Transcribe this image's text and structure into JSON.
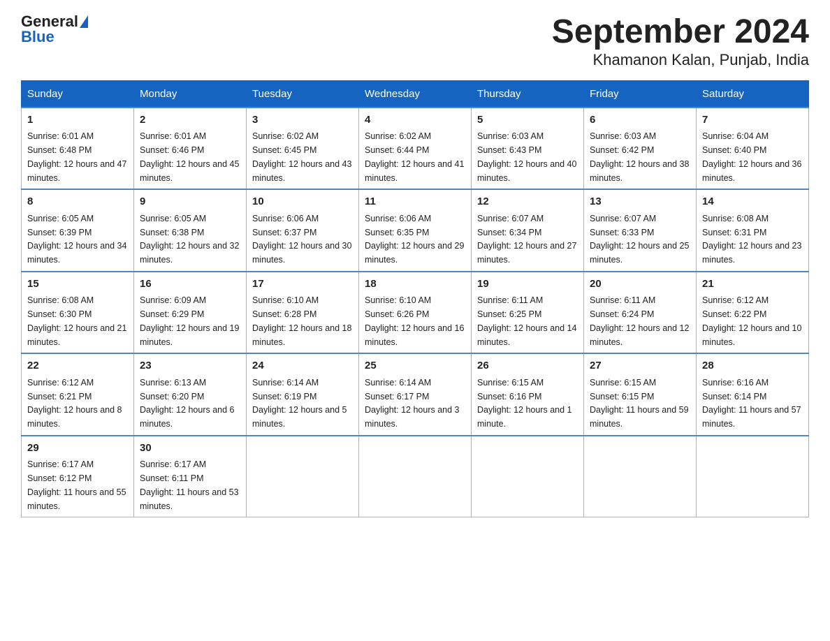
{
  "logo": {
    "general": "General",
    "blue": "Blue"
  },
  "title": "September 2024",
  "subtitle": "Khamanon Kalan, Punjab, India",
  "days_of_week": [
    "Sunday",
    "Monday",
    "Tuesday",
    "Wednesday",
    "Thursday",
    "Friday",
    "Saturday"
  ],
  "weeks": [
    [
      {
        "day": "1",
        "sunrise": "6:01 AM",
        "sunset": "6:48 PM",
        "daylight": "12 hours and 47 minutes."
      },
      {
        "day": "2",
        "sunrise": "6:01 AM",
        "sunset": "6:46 PM",
        "daylight": "12 hours and 45 minutes."
      },
      {
        "day": "3",
        "sunrise": "6:02 AM",
        "sunset": "6:45 PM",
        "daylight": "12 hours and 43 minutes."
      },
      {
        "day": "4",
        "sunrise": "6:02 AM",
        "sunset": "6:44 PM",
        "daylight": "12 hours and 41 minutes."
      },
      {
        "day": "5",
        "sunrise": "6:03 AM",
        "sunset": "6:43 PM",
        "daylight": "12 hours and 40 minutes."
      },
      {
        "day": "6",
        "sunrise": "6:03 AM",
        "sunset": "6:42 PM",
        "daylight": "12 hours and 38 minutes."
      },
      {
        "day": "7",
        "sunrise": "6:04 AM",
        "sunset": "6:40 PM",
        "daylight": "12 hours and 36 minutes."
      }
    ],
    [
      {
        "day": "8",
        "sunrise": "6:05 AM",
        "sunset": "6:39 PM",
        "daylight": "12 hours and 34 minutes."
      },
      {
        "day": "9",
        "sunrise": "6:05 AM",
        "sunset": "6:38 PM",
        "daylight": "12 hours and 32 minutes."
      },
      {
        "day": "10",
        "sunrise": "6:06 AM",
        "sunset": "6:37 PM",
        "daylight": "12 hours and 30 minutes."
      },
      {
        "day": "11",
        "sunrise": "6:06 AM",
        "sunset": "6:35 PM",
        "daylight": "12 hours and 29 minutes."
      },
      {
        "day": "12",
        "sunrise": "6:07 AM",
        "sunset": "6:34 PM",
        "daylight": "12 hours and 27 minutes."
      },
      {
        "day": "13",
        "sunrise": "6:07 AM",
        "sunset": "6:33 PM",
        "daylight": "12 hours and 25 minutes."
      },
      {
        "day": "14",
        "sunrise": "6:08 AM",
        "sunset": "6:31 PM",
        "daylight": "12 hours and 23 minutes."
      }
    ],
    [
      {
        "day": "15",
        "sunrise": "6:08 AM",
        "sunset": "6:30 PM",
        "daylight": "12 hours and 21 minutes."
      },
      {
        "day": "16",
        "sunrise": "6:09 AM",
        "sunset": "6:29 PM",
        "daylight": "12 hours and 19 minutes."
      },
      {
        "day": "17",
        "sunrise": "6:10 AM",
        "sunset": "6:28 PM",
        "daylight": "12 hours and 18 minutes."
      },
      {
        "day": "18",
        "sunrise": "6:10 AM",
        "sunset": "6:26 PM",
        "daylight": "12 hours and 16 minutes."
      },
      {
        "day": "19",
        "sunrise": "6:11 AM",
        "sunset": "6:25 PM",
        "daylight": "12 hours and 14 minutes."
      },
      {
        "day": "20",
        "sunrise": "6:11 AM",
        "sunset": "6:24 PM",
        "daylight": "12 hours and 12 minutes."
      },
      {
        "day": "21",
        "sunrise": "6:12 AM",
        "sunset": "6:22 PM",
        "daylight": "12 hours and 10 minutes."
      }
    ],
    [
      {
        "day": "22",
        "sunrise": "6:12 AM",
        "sunset": "6:21 PM",
        "daylight": "12 hours and 8 minutes."
      },
      {
        "day": "23",
        "sunrise": "6:13 AM",
        "sunset": "6:20 PM",
        "daylight": "12 hours and 6 minutes."
      },
      {
        "day": "24",
        "sunrise": "6:14 AM",
        "sunset": "6:19 PM",
        "daylight": "12 hours and 5 minutes."
      },
      {
        "day": "25",
        "sunrise": "6:14 AM",
        "sunset": "6:17 PM",
        "daylight": "12 hours and 3 minutes."
      },
      {
        "day": "26",
        "sunrise": "6:15 AM",
        "sunset": "6:16 PM",
        "daylight": "12 hours and 1 minute."
      },
      {
        "day": "27",
        "sunrise": "6:15 AM",
        "sunset": "6:15 PM",
        "daylight": "11 hours and 59 minutes."
      },
      {
        "day": "28",
        "sunrise": "6:16 AM",
        "sunset": "6:14 PM",
        "daylight": "11 hours and 57 minutes."
      }
    ],
    [
      {
        "day": "29",
        "sunrise": "6:17 AM",
        "sunset": "6:12 PM",
        "daylight": "11 hours and 55 minutes."
      },
      {
        "day": "30",
        "sunrise": "6:17 AM",
        "sunset": "6:11 PM",
        "daylight": "11 hours and 53 minutes."
      },
      null,
      null,
      null,
      null,
      null
    ]
  ]
}
